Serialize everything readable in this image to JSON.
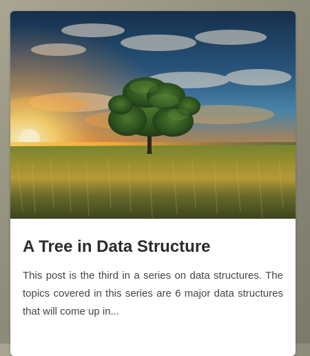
{
  "card": {
    "image_alt": "Tree in a field at sunset",
    "title": "A Tree in Data Structure",
    "excerpt": "This post is the third in a series on data structures. The topics covered in this series are 6 major data structures that will come up in..."
  }
}
